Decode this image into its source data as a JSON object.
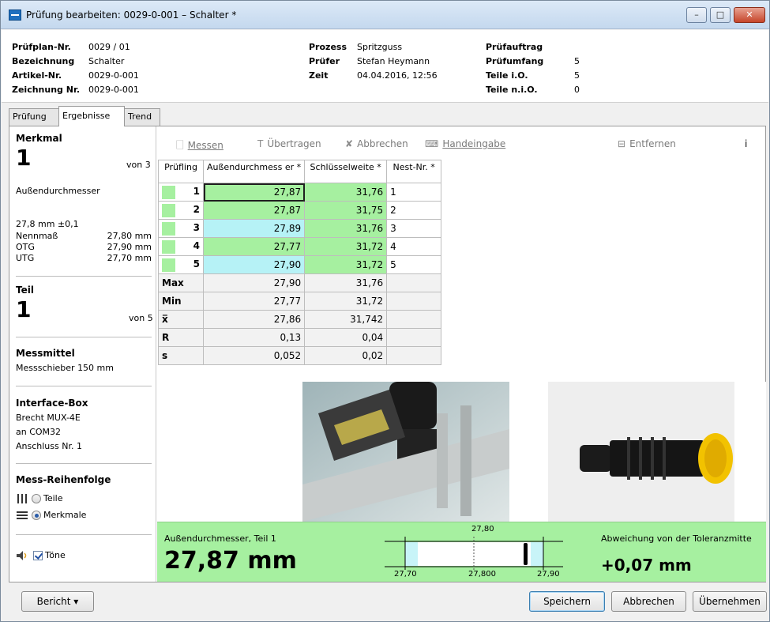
{
  "window": {
    "title": "Prüfung bearbeiten: 0029-0-001 – Schalter *",
    "minimize": "–",
    "maximize": "□",
    "close": "✕"
  },
  "header": {
    "col1": [
      {
        "label": "Prüfplan-Nr.",
        "value": "0029 / 01"
      },
      {
        "label": "Bezeichnung",
        "value": "Schalter"
      },
      {
        "label": "Artikel-Nr.",
        "value": "0029-0-001"
      },
      {
        "label": "Zeichnung Nr.",
        "value": "0029-0-001"
      }
    ],
    "col2": [
      {
        "label": "Prozess",
        "value": "Spritzguss"
      },
      {
        "label": "Prüfer",
        "value": "Stefan Heymann"
      },
      {
        "label": "Zeit",
        "value": "04.04.2016, 12:56"
      }
    ],
    "col3": [
      {
        "label": "Prüfauftrag",
        "value": ""
      },
      {
        "label": "Prüfumfang",
        "value": "5"
      },
      {
        "label": "Teile i.O.",
        "value": "5"
      },
      {
        "label": "Teile n.i.O.",
        "value": "0"
      }
    ]
  },
  "tabs": [
    "Prüfung",
    "Ergebnisse",
    "Trend"
  ],
  "left": {
    "merkmal_title": "Merkmal",
    "merkmal_num": "1",
    "merkmal_of": "von 3",
    "merkmal_name": "Außendurchmesser",
    "tolerance": "27,8 mm ±0,1",
    "specs": [
      {
        "label": "Nennmaß",
        "value": "27,80 mm"
      },
      {
        "label": "OTG",
        "value": "27,90 mm"
      },
      {
        "label": "UTG",
        "value": "27,70 mm"
      }
    ],
    "teil_title": "Teil",
    "teil_num": "1",
    "teil_of": "von 5",
    "messmittel_title": "Messmittel",
    "messmittel_value": "Messschieber 150 mm",
    "interface_title": "Interface-Box",
    "interface_lines": [
      "Brecht MUX-4E",
      "an COM32",
      "Anschluss Nr. 1"
    ],
    "reihenfolge_title": "Mess-Reihenfolge",
    "radio_teile": "Teile",
    "radio_merkmale": "Merkmale",
    "toene": "Töne"
  },
  "toolbar": {
    "messen": "Messen",
    "uebertragen": "Übertragen",
    "abbrechen": "Abbrechen",
    "handeingabe": "Handeingabe",
    "entfernen": "Entfernen",
    "info": "i"
  },
  "table": {
    "headers": [
      "Prüfling",
      "Außendurchmess er *",
      "Schlüsselweite *",
      "Nest-Nr. *"
    ],
    "rows": [
      {
        "n": "1",
        "a": "27,87",
        "s": "31,76",
        "nest": "1",
        "color": "#a6f0a0"
      },
      {
        "n": "2",
        "a": "27,87",
        "s": "31,75",
        "nest": "2",
        "color": "#a6f0a0"
      },
      {
        "n": "3",
        "a": "27,89",
        "s": "31,76",
        "nest": "3",
        "color": "#a6f0a0"
      },
      {
        "n": "4",
        "a": "27,77",
        "s": "31,72",
        "nest": "4",
        "color": "#a6f0a0"
      },
      {
        "n": "5",
        "a": "27,90",
        "s": "31,72",
        "nest": "5",
        "color": "#a6f0a0"
      }
    ],
    "stats": [
      {
        "label": "Max",
        "a": "27,90",
        "s": "31,76"
      },
      {
        "label": "Min",
        "a": "27,77",
        "s": "31,72"
      },
      {
        "label": "x̅",
        "a": "27,86",
        "s": "31,742"
      },
      {
        "label": "R",
        "a": "0,13",
        "s": "0,04"
      },
      {
        "label": "s",
        "a": "0,052",
        "s": "0,02"
      }
    ]
  },
  "status": {
    "label": "Außendurchmesser, Teil 1",
    "value": "27,87 mm",
    "scale_top": "27,80",
    "scale_left": "27,70",
    "scale_mid": "27,800",
    "scale_right": "27,90",
    "deviation_label": "Abweichung von der Toleranzmitte",
    "deviation_value": "+0,07 mm",
    "color": "#a6f0a0"
  },
  "footer": {
    "bericht": "Bericht",
    "speichern": "Speichern",
    "abbrechen": "Abbrechen",
    "uebernehmen": "Übernehmen"
  }
}
